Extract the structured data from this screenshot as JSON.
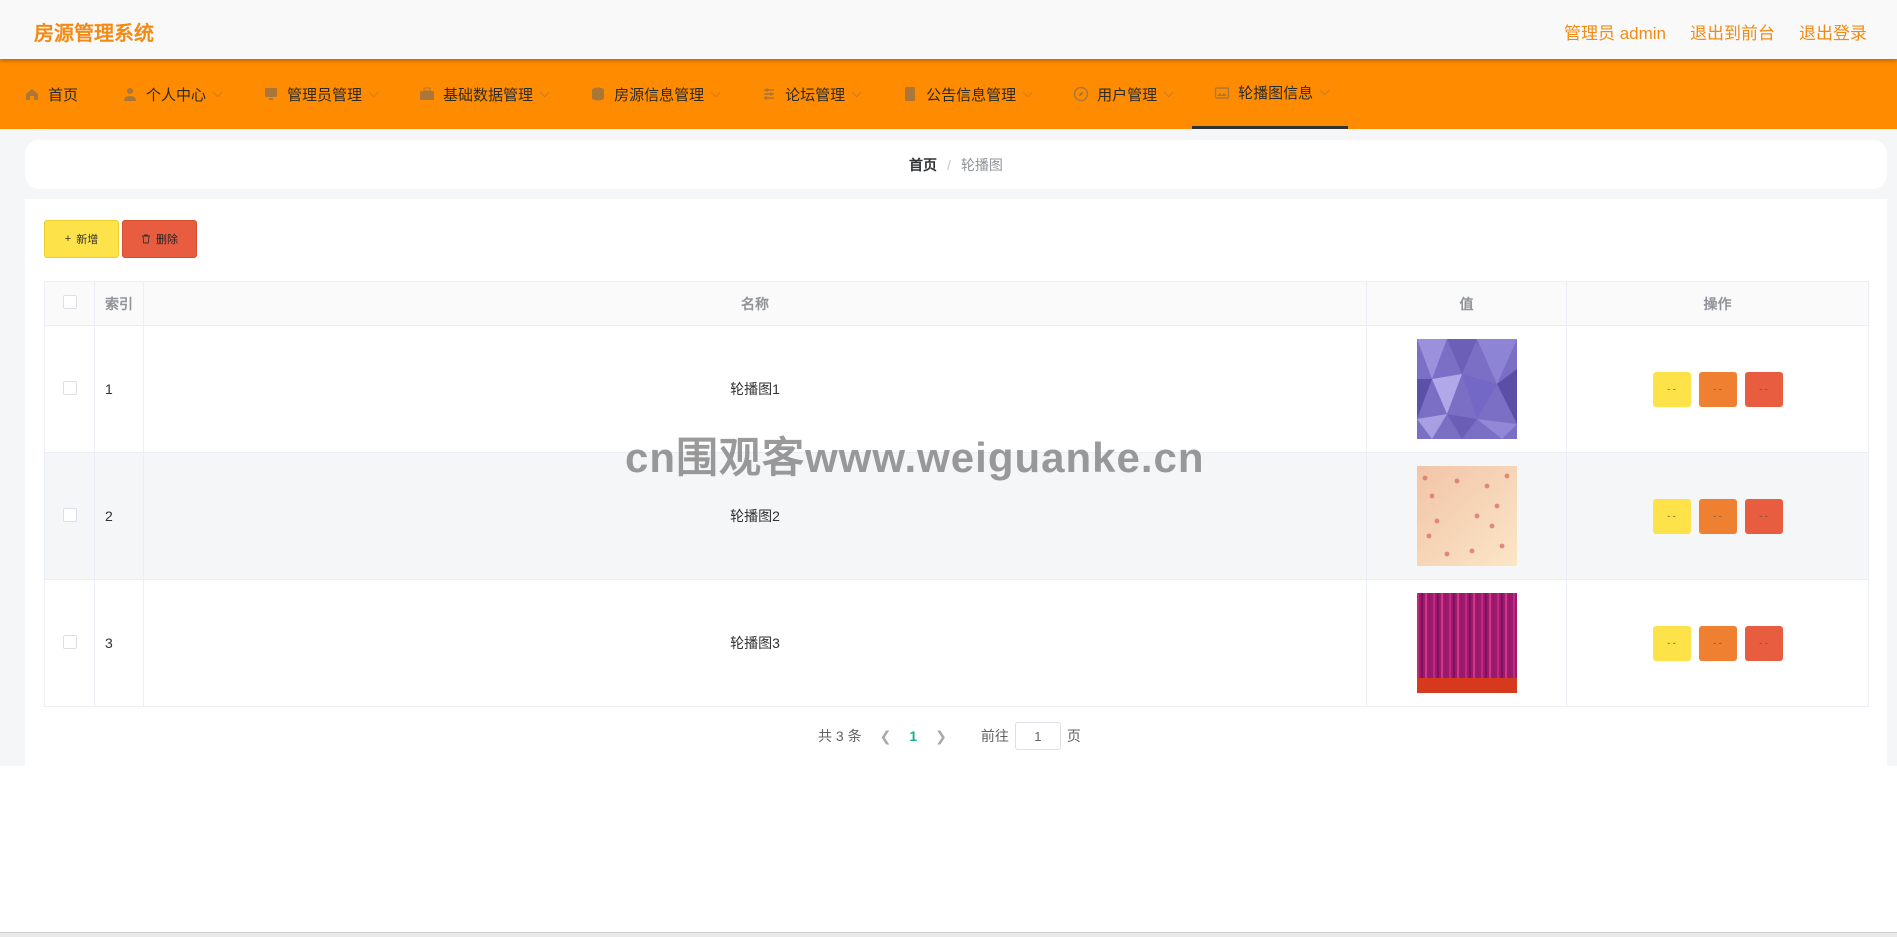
{
  "header": {
    "title": "房源管理系统",
    "links": [
      "管理员 admin",
      "退出到前台",
      "退出登录"
    ]
  },
  "nav": [
    {
      "label": "首页",
      "icon": "home-icon",
      "caret": false,
      "active": false
    },
    {
      "label": "个人中心",
      "icon": "user-icon",
      "caret": true,
      "active": false
    },
    {
      "label": "管理员管理",
      "icon": "monitor-icon",
      "caret": true,
      "active": false
    },
    {
      "label": "基础数据管理",
      "icon": "briefcase-icon",
      "caret": true,
      "active": false
    },
    {
      "label": "房源信息管理",
      "icon": "database-icon",
      "caret": true,
      "active": false
    },
    {
      "label": "论坛管理",
      "icon": "sliders-icon",
      "caret": true,
      "active": false
    },
    {
      "label": "公告信息管理",
      "icon": "document-icon",
      "caret": true,
      "active": false
    },
    {
      "label": "用户管理",
      "icon": "compass-icon",
      "caret": true,
      "active": false
    },
    {
      "label": "轮播图信息",
      "icon": "picture-icon",
      "caret": true,
      "active": true
    }
  ],
  "breadcrumb": {
    "home": "首页",
    "separator": "/",
    "current": "轮播图"
  },
  "toolbar": {
    "add_label": "新增",
    "delete_label": "删除"
  },
  "table": {
    "columns": [
      "索引",
      "名称",
      "值",
      "操作"
    ],
    "rows": [
      {
        "index": "1",
        "name": "轮播图1",
        "image": "purple-geometric"
      },
      {
        "index": "2",
        "name": "轮播图2",
        "image": "peach-floral"
      },
      {
        "index": "3",
        "name": "轮播图3",
        "image": "magenta-stripes"
      }
    ],
    "op_label": "- -"
  },
  "pagination": {
    "total_text": "共 3 条",
    "current_page": "1",
    "goto_label": "前往",
    "goto_value": "1",
    "page_suffix": "页"
  },
  "watermark": "cn围观客www.weiguanke.cn",
  "colors": {
    "brand": "#f28b16",
    "navbar": "#ff8c00",
    "add": "#fde349",
    "delete": "#e85d40",
    "edit": "#ef7f31",
    "page_active": "#18b38a"
  }
}
